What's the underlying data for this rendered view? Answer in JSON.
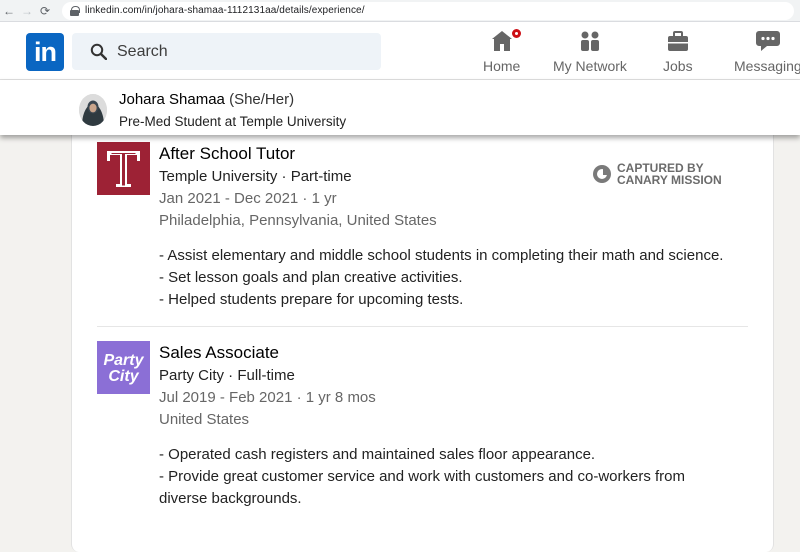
{
  "browser": {
    "url": "linkedin.com/in/johara-shamaa-1112131aa/details/experience/"
  },
  "nav": {
    "logo_text": "in",
    "search_placeholder": "Search",
    "items": [
      {
        "label": "Home",
        "icon": "home-icon"
      },
      {
        "label": "My Network",
        "icon": "network-icon"
      },
      {
        "label": "Jobs",
        "icon": "briefcase-icon"
      },
      {
        "label": "Messaging",
        "icon": "messaging-icon"
      }
    ],
    "accent": "#0a66c2"
  },
  "profile": {
    "name": "Johara Shamaa",
    "pronouns": "(She/Her)",
    "headline": "Pre-Med Student at Temple University"
  },
  "watermark": {
    "line1": "CAPTURED BY",
    "line2": "CANARY MISSION"
  },
  "experiences": [
    {
      "title": "After School Tutor",
      "company": "Temple University · Part-time",
      "dates": "Jan 2021 - Dec 2021 · 1 yr",
      "location": "Philadelphia, Pennsylvania, United States",
      "logo": "temple-university-logo",
      "logo_text": "T",
      "logo_color": "#9d2235",
      "description": [
        "- Assist elementary and middle school students in completing their math and science.",
        "- Set lesson goals and plan creative activities.",
        "- Helped students prepare for upcoming tests."
      ]
    },
    {
      "title": "Sales Associate",
      "company": "Party City · Full-time",
      "dates": "Jul 2019 - Feb 2021 · 1 yr 8 mos",
      "location": "United States",
      "logo": "party-city-logo",
      "logo_text_1": "Party",
      "logo_text_2": "City",
      "logo_color": "#8b6fd6",
      "description": [
        "- Operated cash registers and maintained sales floor appearance.",
        "- Provide great customer service and work with customers and co-workers from diverse backgrounds."
      ]
    }
  ]
}
